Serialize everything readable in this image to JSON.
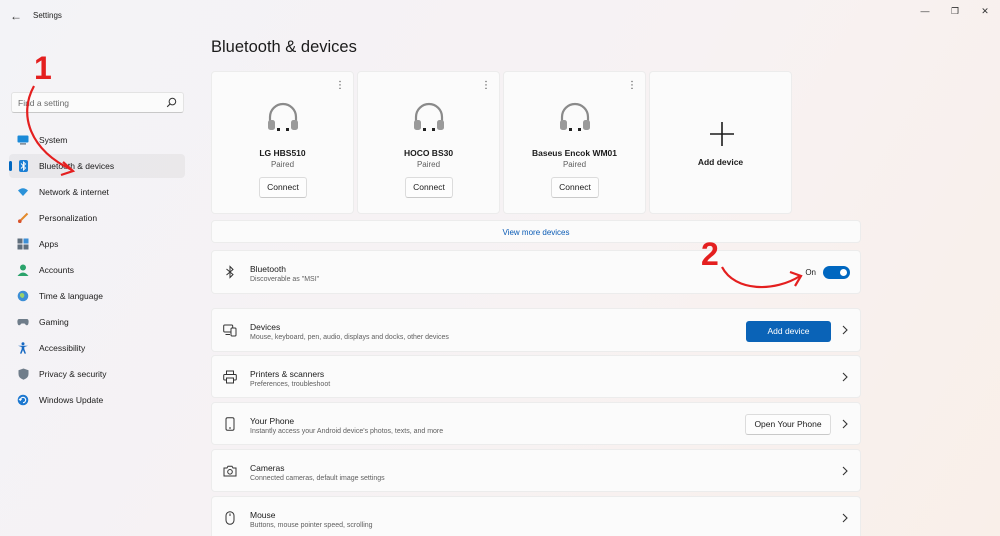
{
  "window": {
    "app_title": "Settings",
    "back_glyph": "←",
    "min_glyph": "—",
    "max_glyph": "❐",
    "close_glyph": "✕"
  },
  "search": {
    "placeholder": "Find a setting"
  },
  "sidebar": {
    "items": [
      {
        "label": "System",
        "icon": "system-icon"
      },
      {
        "label": "Bluetooth & devices",
        "icon": "bluetooth-icon",
        "active": true
      },
      {
        "label": "Network & internet",
        "icon": "wifi-icon"
      },
      {
        "label": "Personalization",
        "icon": "brush-icon"
      },
      {
        "label": "Apps",
        "icon": "apps-icon"
      },
      {
        "label": "Accounts",
        "icon": "account-icon"
      },
      {
        "label": "Time & language",
        "icon": "globe-icon"
      },
      {
        "label": "Gaming",
        "icon": "gamepad-icon"
      },
      {
        "label": "Accessibility",
        "icon": "accessibility-icon"
      },
      {
        "label": "Privacy & security",
        "icon": "shield-icon"
      },
      {
        "label": "Windows Update",
        "icon": "update-icon"
      }
    ]
  },
  "main": {
    "title": "Bluetooth & devices",
    "devices": [
      {
        "name": "LG HBS510",
        "status": "Paired",
        "action": "Connect"
      },
      {
        "name": "HOCO BS30",
        "status": "Paired",
        "action": "Connect"
      },
      {
        "name": "Baseus Encok WM01",
        "status": "Paired",
        "action": "Connect"
      }
    ],
    "add_device_card": "Add device",
    "more_glyph": "⋮",
    "view_more": "View more devices",
    "bluetooth": {
      "title": "Bluetooth",
      "subtitle": "Discoverable as \"MSI\"",
      "state": "On"
    },
    "rows": [
      {
        "title": "Devices",
        "subtitle": "Mouse, keyboard, pen, audio, displays and docks, other devices",
        "button": "Add device",
        "icon": "devices-icon"
      },
      {
        "title": "Printers & scanners",
        "subtitle": "Preferences, troubleshoot",
        "icon": "printer-icon"
      },
      {
        "title": "Your Phone",
        "subtitle": "Instantly access your Android device's photos, texts, and more",
        "button": "Open Your Phone",
        "icon": "phone-icon"
      },
      {
        "title": "Cameras",
        "subtitle": "Connected cameras, default image settings",
        "icon": "camera-icon"
      },
      {
        "title": "Mouse",
        "subtitle": "Buttons, mouse pointer speed, scrolling",
        "icon": "mouse-icon"
      }
    ]
  },
  "annotations": {
    "step1": "1",
    "step2": "2"
  },
  "colors": {
    "accent": "#0067c0",
    "annotation": "#e41f1f"
  }
}
